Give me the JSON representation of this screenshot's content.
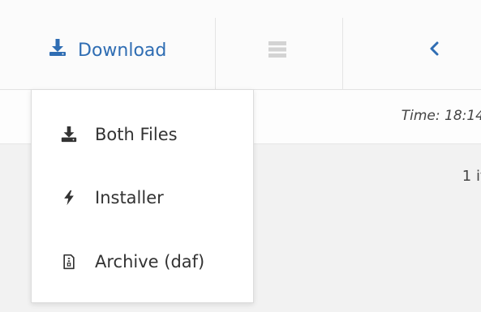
{
  "toolbar": {
    "download_label": "Download",
    "accent_color": "#2f6db3",
    "icons": {
      "download": "download-icon",
      "grid": "grid-icon",
      "previous": "chevron-left-icon"
    }
  },
  "info_bar": {
    "time_label": "Time: 18:14"
  },
  "content": {
    "items_count": "1 it"
  },
  "download_menu": {
    "items": [
      {
        "label": "Both Files",
        "icon": "download-icon"
      },
      {
        "label": "Installer",
        "icon": "bolt-icon"
      },
      {
        "label": "Archive (daf)",
        "icon": "file-archive-icon"
      }
    ]
  }
}
